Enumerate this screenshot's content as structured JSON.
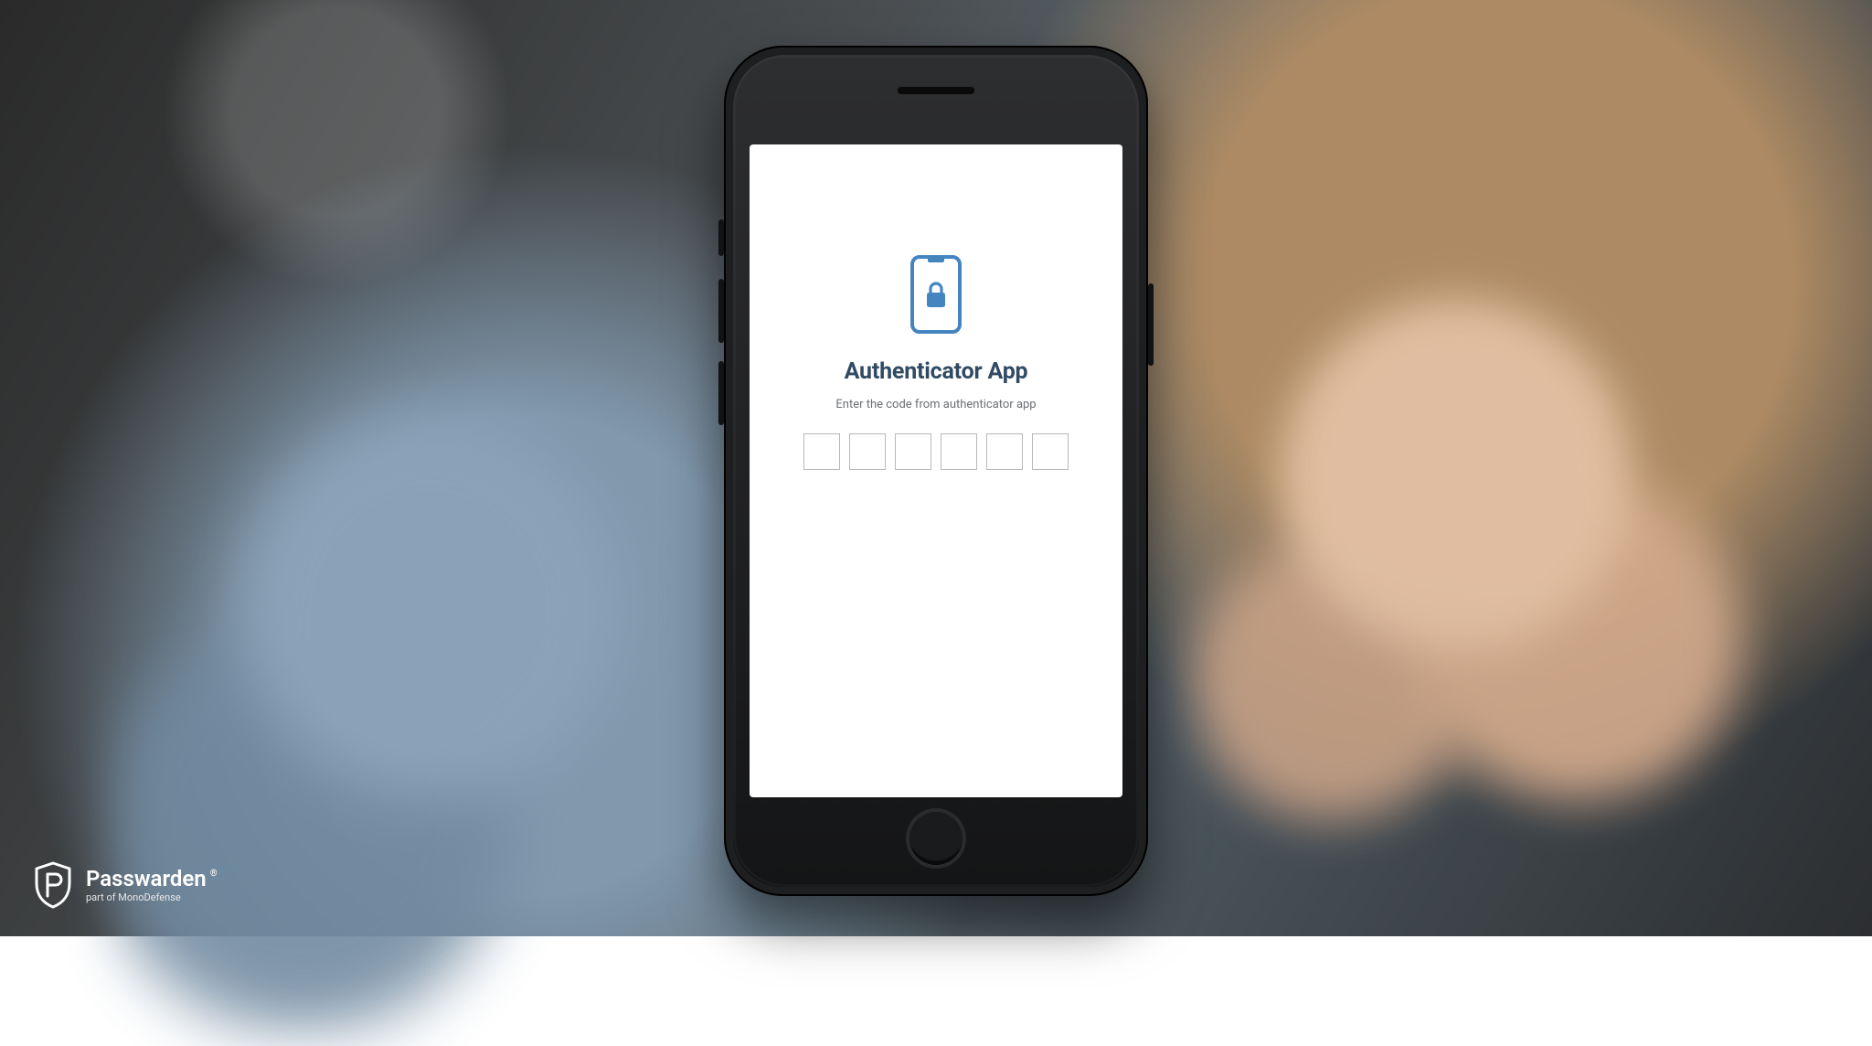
{
  "screen": {
    "title": "Authenticator App",
    "subtitle": "Enter the code from authenticator app",
    "code": [
      "",
      "",
      "",
      "",
      "",
      ""
    ]
  },
  "watermark": {
    "name": "Passwarden",
    "registered": "®",
    "subtitle": "part of MonoDefense"
  },
  "colors": {
    "accent": "#3f86c7",
    "titleColor": "#2e4a66"
  }
}
